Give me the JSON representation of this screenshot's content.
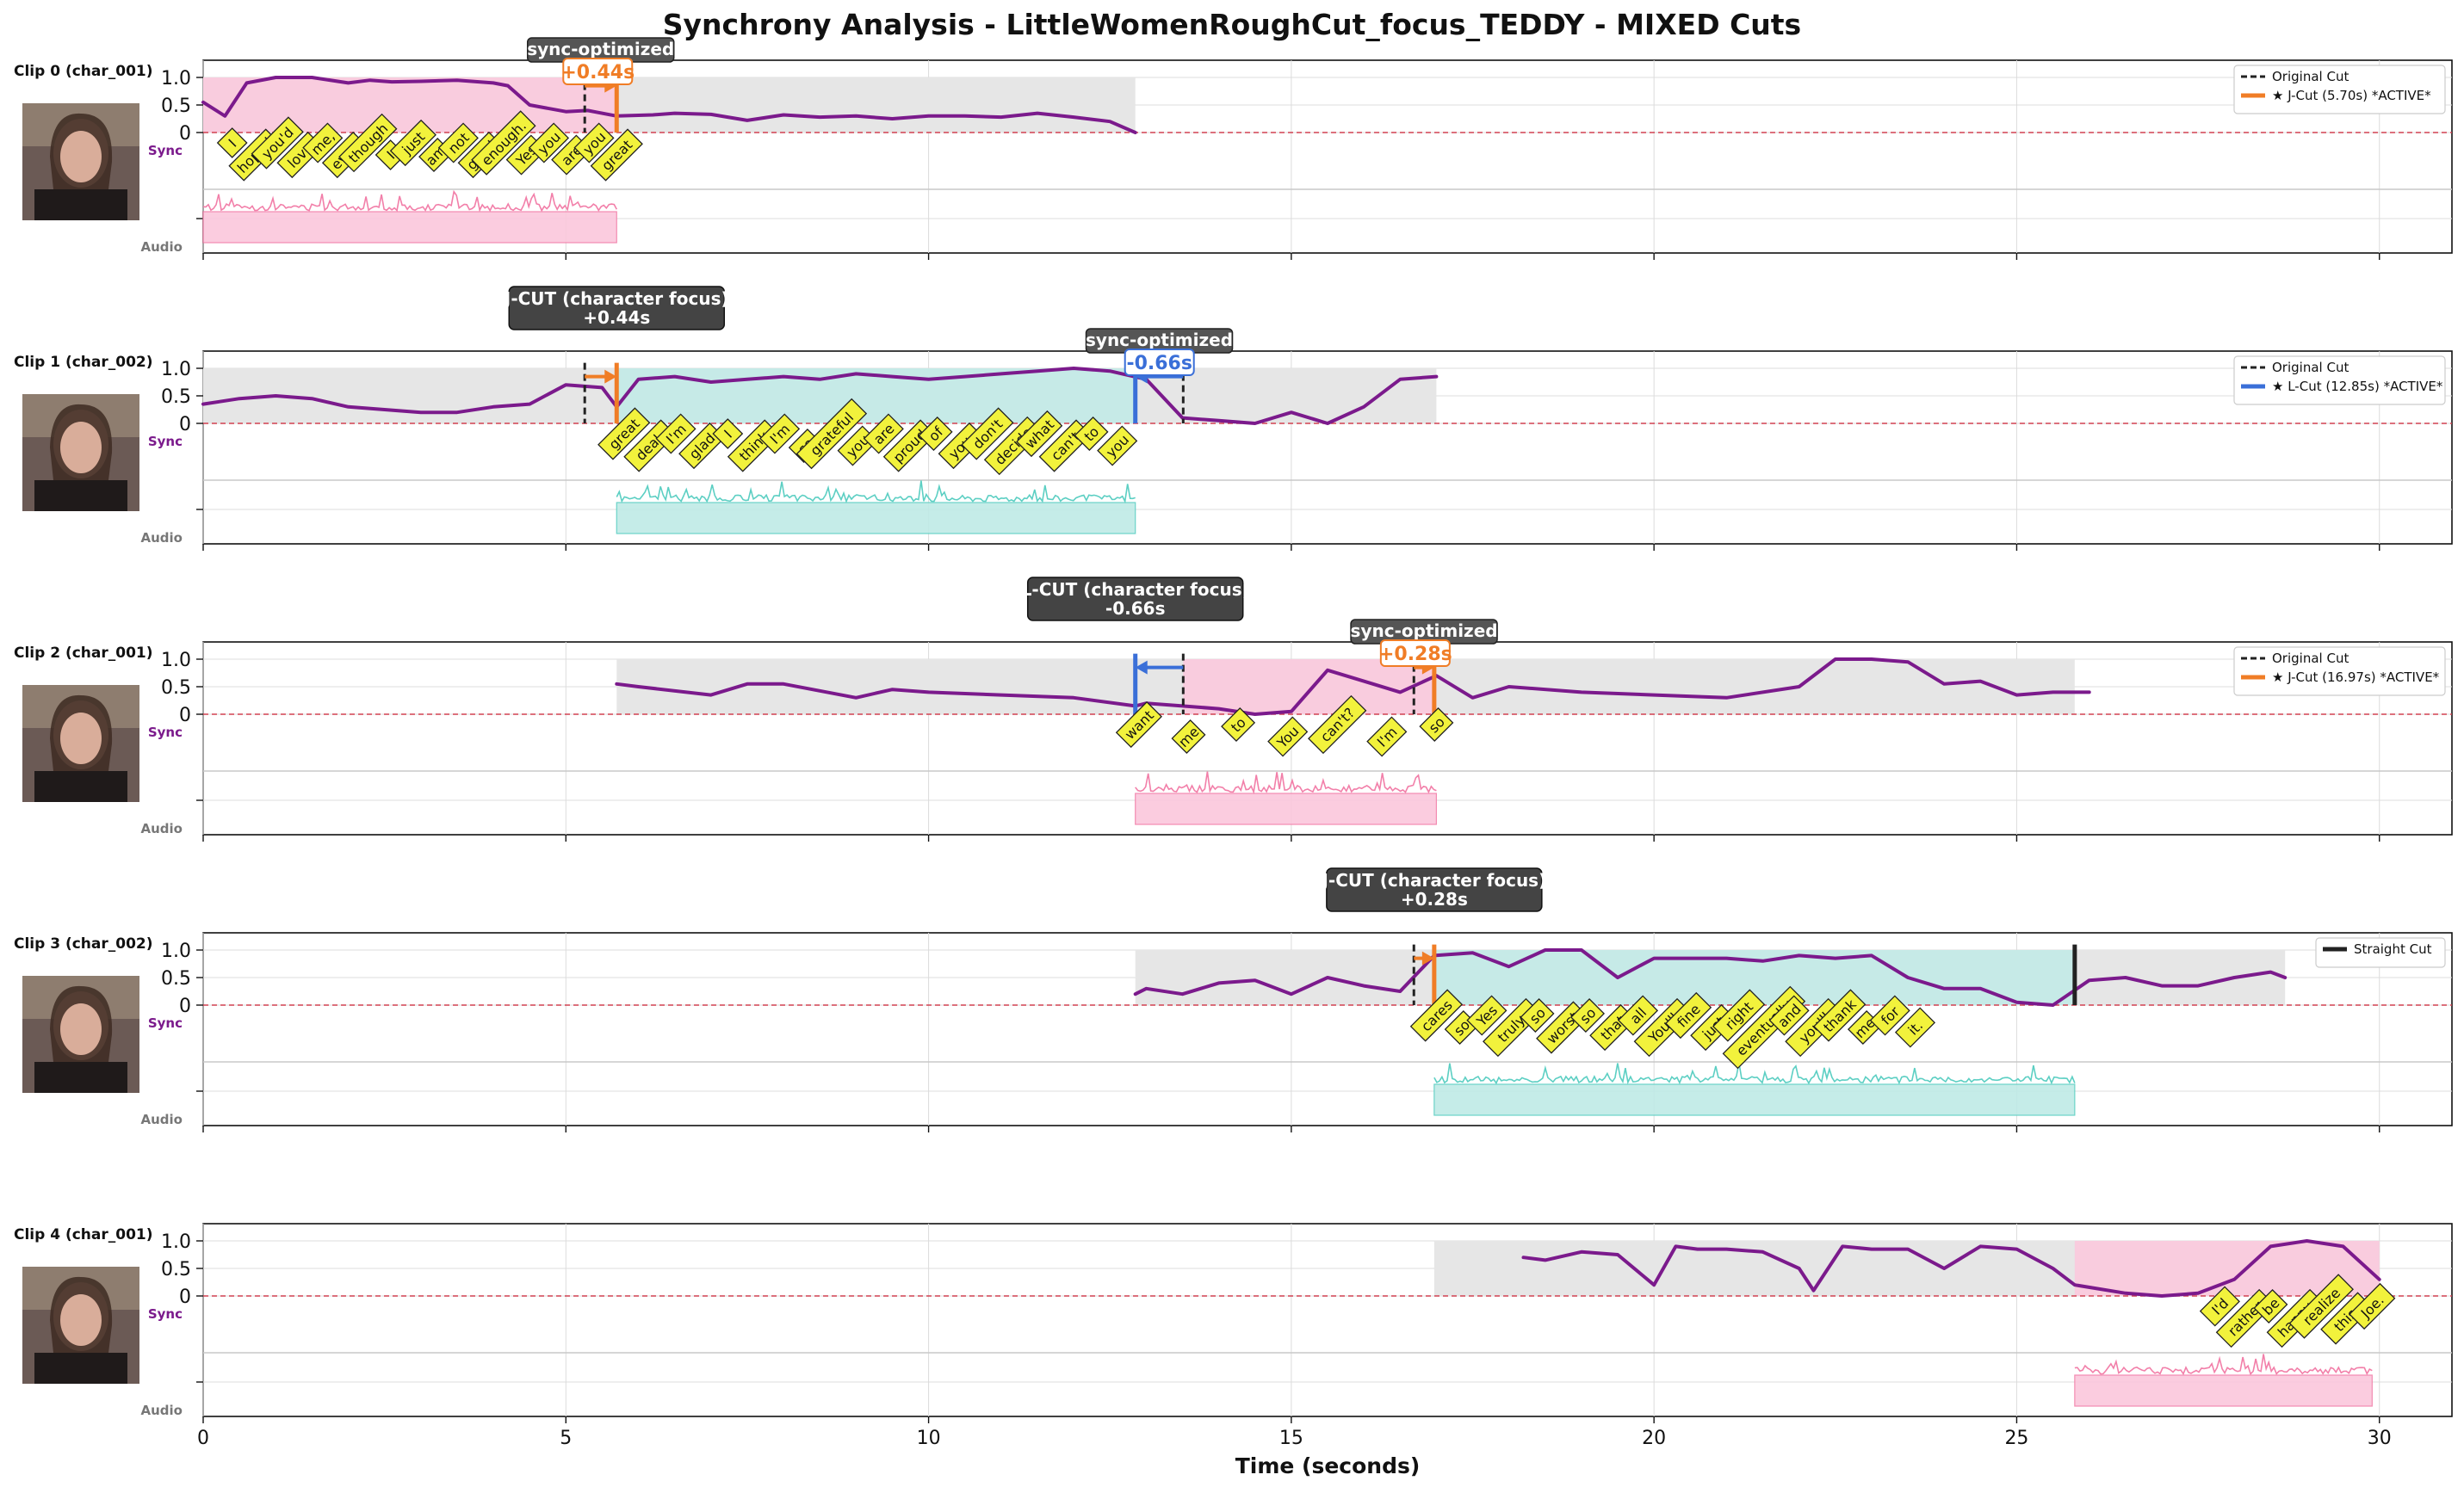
{
  "title": "Synchrony Analysis - LittleWomenRoughCut_focus_TEDDY - MIXED Cuts",
  "xlabel": "Time (seconds)",
  "colors": {
    "sync_line": "#7b1a8c",
    "char_001": "#f27fa9",
    "char_001_fill": "#fbc7dc",
    "char_002": "#5ccfc3",
    "char_002_fill": "#bfeae6",
    "context_fill": "#e6e6e6",
    "jcut": "#f07d26",
    "lcut": "#3a6fd8",
    "original_cut": "#222222",
    "zero_line": "#d04050",
    "word_tag": "#f2f23c",
    "annotation_box": "#444444"
  },
  "chart_data": {
    "type": "line",
    "xlim": [
      0,
      31
    ],
    "x_ticks": [
      0,
      5,
      10,
      15,
      20,
      25,
      30
    ],
    "y_ticks": [
      0,
      0.5,
      1.0
    ],
    "y_tick_labels": [
      "0",
      "0.5",
      "1.0"
    ],
    "grid": true,
    "clips": [
      {
        "label": "Clip 0 (char_001)",
        "char": "char_001",
        "sync_label": "Sync",
        "audio_label": "Audio",
        "context_span": [
          0,
          12.85
        ],
        "active_span": [
          0,
          5.7
        ],
        "audio_span": [
          0,
          5.7
        ],
        "original_cut": 5.26,
        "new_cut": 5.7,
        "cut_kind": "jcut",
        "straight_cut": null,
        "legend": [
          "Original Cut",
          "★ J-Cut (5.70s) *ACTIVE*"
        ],
        "top_annotation": null,
        "sync_annotation": "sync-optimized",
        "offset_annotation": "+0.44s",
        "sync_x": [
          0,
          0.3,
          0.6,
          1.0,
          1.5,
          2.0,
          2.3,
          2.6,
          3.0,
          3.5,
          4.0,
          4.2,
          4.5,
          5.0,
          5.3,
          5.7,
          6.2,
          6.5,
          7.0,
          7.5,
          8.0,
          8.5,
          9.0,
          9.5,
          10.0,
          10.5,
          11.0,
          11.5,
          12.0,
          12.5,
          12.85
        ],
        "sync_y": [
          0.55,
          0.3,
          0.9,
          1.0,
          1.0,
          0.9,
          0.95,
          0.92,
          0.93,
          0.95,
          0.9,
          0.85,
          0.5,
          0.38,
          0.4,
          0.3,
          0.32,
          0.35,
          0.33,
          0.22,
          0.32,
          0.28,
          0.3,
          0.25,
          0.3,
          0.3,
          0.28,
          0.35,
          0.28,
          0.2,
          0.0
        ],
        "words": [
          "I",
          "hoped",
          "you'd",
          "love",
          "me,",
          "even",
          "though",
          "I",
          "just",
          "am",
          "not",
          "good",
          "enough.",
          "Yes",
          "you",
          "are",
          "you",
          "great"
        ],
        "words_span": [
          0.4,
          5.7
        ]
      },
      {
        "label": "Clip 1 (char_002)",
        "char": "char_002",
        "sync_label": "Sync",
        "audio_label": "Audio",
        "context_span": [
          0,
          17.0
        ],
        "active_span": [
          5.7,
          12.85
        ],
        "audio_span": [
          5.7,
          12.85
        ],
        "original_cut": 13.51,
        "new_cut": 12.85,
        "cut_kind": "lcut",
        "prev_original_cut": 5.26,
        "prev_new_cut": 5.7,
        "straight_cut": null,
        "legend": [
          "Original Cut",
          "★ L-Cut (12.85s) *ACTIVE*"
        ],
        "top_annotation": [
          "J-CUT (character focus)",
          "+0.44s"
        ],
        "sync_annotation": "sync-optimized",
        "offset_annotation": "-0.66s",
        "sync_x": [
          0,
          0.5,
          1.0,
          1.5,
          2.0,
          2.5,
          3.0,
          3.5,
          4.0,
          4.5,
          5.0,
          5.5,
          5.7,
          6.0,
          6.5,
          7.0,
          7.5,
          8.0,
          8.5,
          9.0,
          9.5,
          10.0,
          10.5,
          11.0,
          11.5,
          12.0,
          12.5,
          13.0,
          13.5,
          14.0,
          14.5,
          15.0,
          15.5,
          16.0,
          16.5,
          17.0
        ],
        "sync_y": [
          0.35,
          0.45,
          0.5,
          0.45,
          0.3,
          0.25,
          0.2,
          0.2,
          0.3,
          0.35,
          0.7,
          0.65,
          0.3,
          0.8,
          0.85,
          0.75,
          0.8,
          0.85,
          0.8,
          0.9,
          0.85,
          0.8,
          0.85,
          0.9,
          0.95,
          1.0,
          0.95,
          0.8,
          0.1,
          0.05,
          0.0,
          0.2,
          0.0,
          0.3,
          0.8,
          0.85
        ],
        "words": [
          "great",
          "deal,",
          "I'm",
          "glad",
          "I",
          "think",
          "I'm",
          "so",
          "grateful",
          "you",
          "are",
          "proud",
          "of",
          "you.",
          "don't",
          "decide",
          "what",
          "can't",
          "to",
          "you"
        ],
        "words_span": [
          5.8,
          12.6
        ]
      },
      {
        "label": "Clip 2 (char_001)",
        "char": "char_001",
        "sync_label": "Sync",
        "audio_label": "Audio",
        "context_span": [
          5.7,
          25.8
        ],
        "active_span": [
          13.51,
          17.0
        ],
        "audio_span": [
          12.85,
          17.0
        ],
        "original_cut": 16.69,
        "new_cut": 16.97,
        "cut_kind": "jcut",
        "prev_original_cut": 13.51,
        "prev_new_cut": 12.85,
        "prev_kind": "lcut",
        "straight_cut": null,
        "legend": [
          "Original Cut",
          "★ J-Cut (16.97s) *ACTIVE*"
        ],
        "top_annotation": [
          "L-CUT (character focus)",
          "-0.66s"
        ],
        "sync_annotation": "sync-optimized",
        "offset_annotation": "+0.28s",
        "sync_x": [
          5.7,
          6.0,
          7.0,
          7.5,
          8.0,
          9.0,
          9.5,
          10.0,
          11.0,
          12.0,
          12.85,
          13.0,
          13.5,
          14.0,
          14.5,
          15.0,
          15.5,
          16.0,
          16.5,
          17.0,
          17.5,
          18.0,
          19.0,
          20.0,
          21.0,
          22.0,
          22.5,
          23.0,
          23.5,
          24.0,
          24.5,
          25.0,
          25.5,
          26.0
        ],
        "sync_y": [
          0.55,
          0.5,
          0.35,
          0.55,
          0.55,
          0.3,
          0.45,
          0.4,
          0.35,
          0.3,
          0.15,
          0.2,
          0.15,
          0.1,
          0.0,
          0.05,
          0.8,
          0.6,
          0.4,
          0.7,
          0.3,
          0.5,
          0.4,
          0.35,
          0.3,
          0.5,
          1.0,
          1.0,
          0.95,
          0.55,
          0.6,
          0.35,
          0.4,
          0.4
        ],
        "words": [
          "want",
          "me",
          "to",
          "You",
          "can't?",
          "I'm",
          "so"
        ],
        "words_span": [
          12.9,
          17.0
        ]
      },
      {
        "label": "Clip 3 (char_002)",
        "char": "char_002",
        "sync_label": "Sync",
        "audio_label": "Audio",
        "context_span": [
          12.85,
          28.7
        ],
        "active_span": [
          16.97,
          25.8
        ],
        "audio_span": [
          16.97,
          25.8
        ],
        "original_cut": null,
        "new_cut": null,
        "cut_kind": null,
        "prev_original_cut": 16.69,
        "prev_new_cut": 16.97,
        "prev_kind": "jcut",
        "straight_cut": 25.8,
        "legend": [
          "Straight Cut"
        ],
        "top_annotation": [
          "J-CUT (character focus)",
          "+0.28s"
        ],
        "sync_annotation": null,
        "offset_annotation": null,
        "sync_x": [
          12.85,
          13.0,
          13.5,
          14.0,
          14.5,
          15.0,
          15.5,
          16.0,
          16.5,
          16.97,
          17.5,
          18.0,
          18.5,
          19.0,
          19.5,
          20.0,
          20.5,
          21.0,
          21.5,
          22.0,
          22.5,
          23.0,
          23.5,
          24.0,
          24.5,
          25.0,
          25.5,
          26.0,
          26.5,
          27.0,
          27.5,
          28.0,
          28.5,
          28.7
        ],
        "sync_y": [
          0.2,
          0.3,
          0.2,
          0.4,
          0.45,
          0.2,
          0.5,
          0.35,
          0.25,
          0.9,
          0.95,
          0.7,
          1.0,
          1.0,
          0.5,
          0.85,
          0.85,
          0.85,
          0.8,
          0.9,
          0.85,
          0.9,
          0.5,
          0.3,
          0.3,
          0.05,
          0.0,
          0.45,
          0.5,
          0.35,
          0.35,
          0.5,
          0.6,
          0.5
        ],
        "words": [
          "cares",
          "so",
          "Yes",
          "truly.",
          "so",
          "worst",
          "so",
          "that",
          "all",
          "You'll",
          "fine",
          "just",
          "right",
          "eventually",
          "and",
          "you'll",
          "thank",
          "me",
          "for",
          "it."
        ],
        "words_span": [
          17.0,
          23.6
        ]
      },
      {
        "label": "Clip 4 (char_001)",
        "char": "char_001",
        "sync_label": "Sync",
        "audio_label": "Audio",
        "context_span": [
          16.97,
          30.0
        ],
        "active_span": [
          25.8,
          30.0
        ],
        "audio_span": [
          25.8,
          29.9
        ],
        "original_cut": null,
        "new_cut": null,
        "cut_kind": null,
        "straight_cut": null,
        "legend": [],
        "top_annotation": null,
        "sync_annotation": null,
        "offset_annotation": null,
        "sync_x": [
          18.2,
          18.5,
          19.0,
          19.5,
          20.0,
          20.3,
          20.6,
          21.0,
          21.5,
          22.0,
          22.2,
          22.6,
          23.0,
          23.5,
          24.0,
          24.5,
          25.0,
          25.5,
          25.8,
          26.5,
          27.0,
          27.5,
          28.0,
          28.5,
          29.0,
          29.5,
          30.0
        ],
        "sync_y": [
          0.7,
          0.65,
          0.8,
          0.75,
          0.2,
          0.9,
          0.85,
          0.85,
          0.8,
          0.5,
          0.1,
          0.9,
          0.85,
          0.85,
          0.5,
          0.9,
          0.85,
          0.5,
          0.2,
          0.05,
          0.0,
          0.05,
          0.3,
          0.9,
          1.0,
          0.9,
          0.3
        ],
        "words": [
          "I'd",
          "rather",
          "be",
          "happy.",
          "realize",
          "this,",
          "Joe."
        ],
        "words_span": [
          27.8,
          29.9
        ]
      }
    ]
  }
}
